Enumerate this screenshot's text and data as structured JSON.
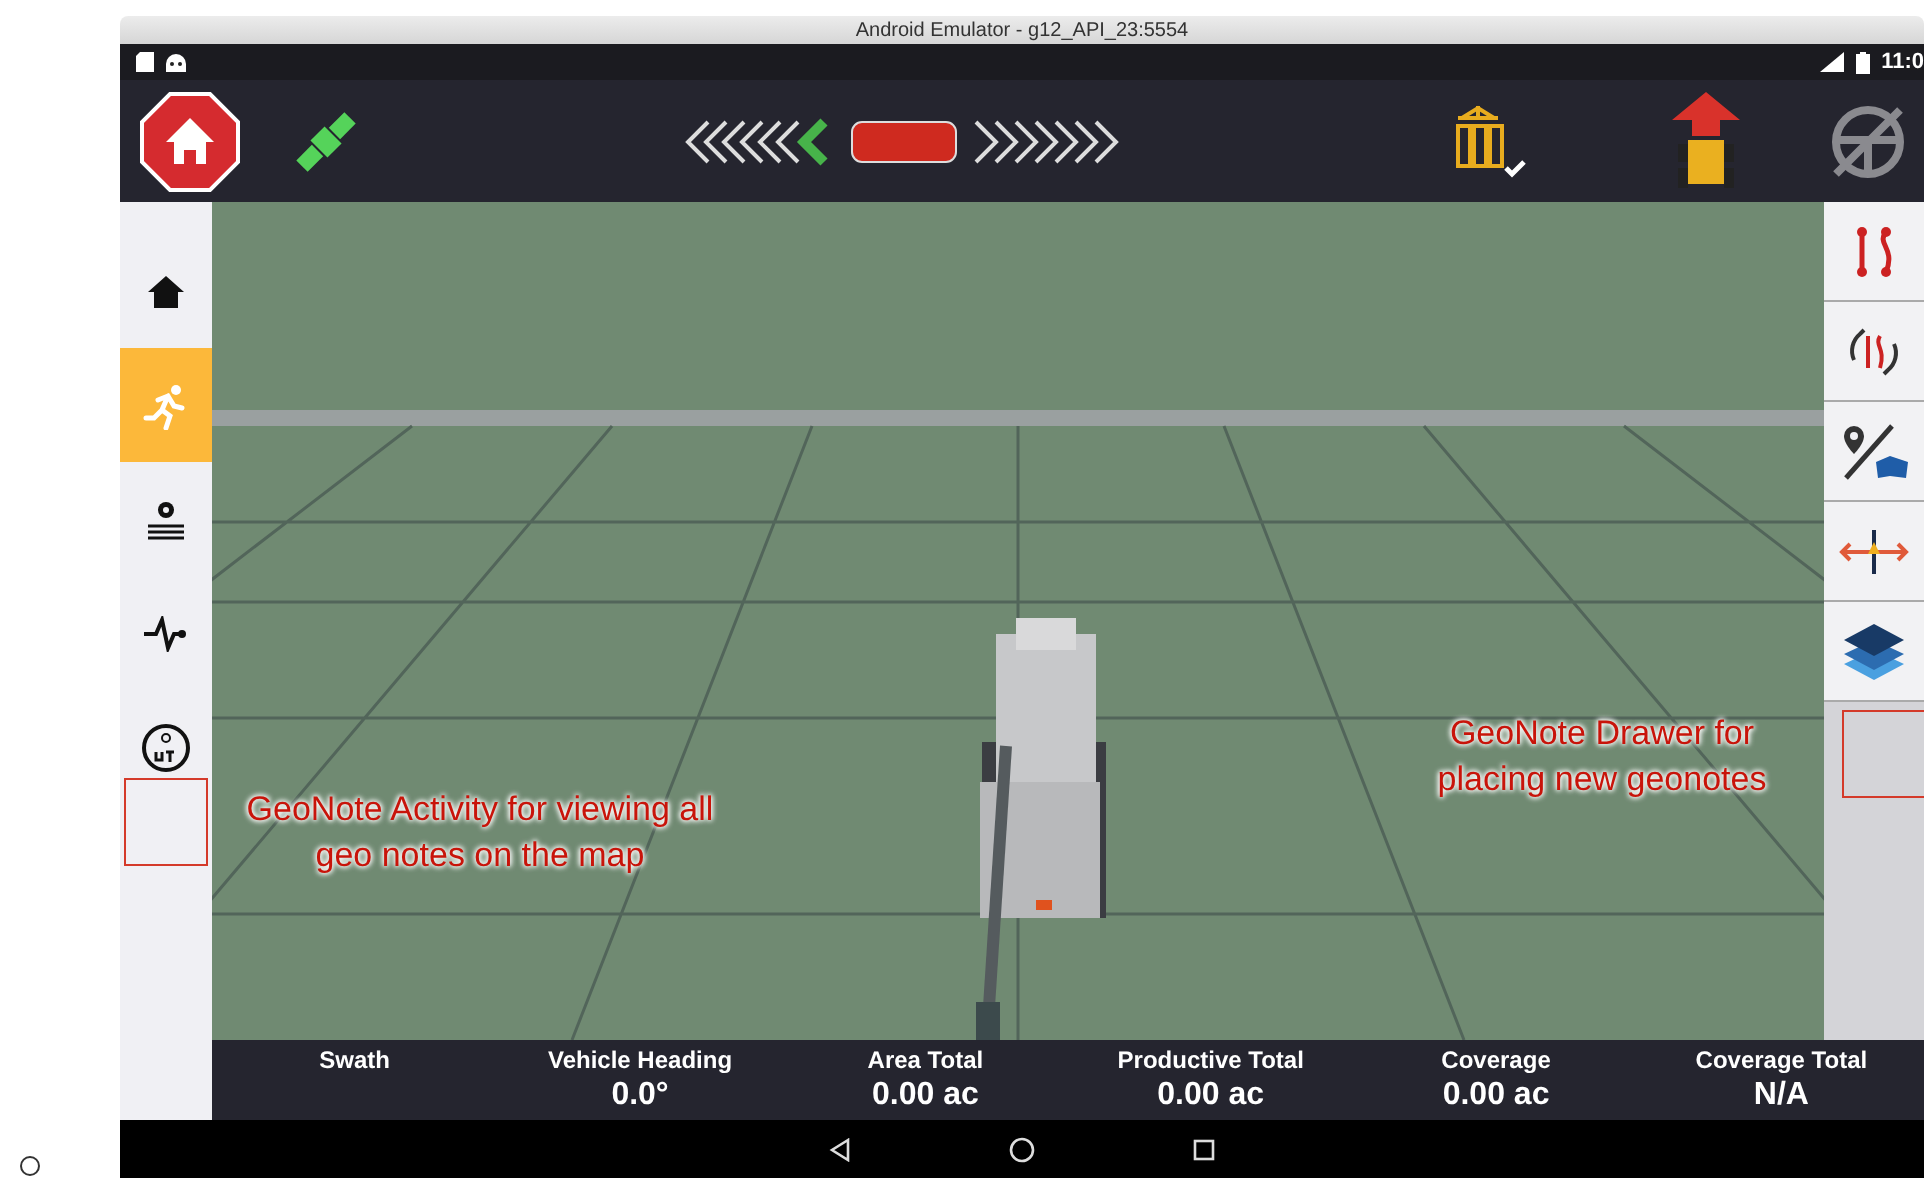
{
  "window": {
    "title": "Android Emulator - g12_API_23:5554"
  },
  "status_bar": {
    "time": "11:0"
  },
  "sidebar": {
    "items": [
      {
        "kind": "home",
        "selected": false
      },
      {
        "kind": "runner",
        "selected": true
      },
      {
        "kind": "field",
        "selected": false
      },
      {
        "kind": "pulse",
        "selected": false
      },
      {
        "kind": "ut",
        "selected": false
      }
    ]
  },
  "tools": {
    "items": [
      {
        "kind": "path"
      },
      {
        "kind": "cycle"
      },
      {
        "kind": "pin"
      },
      {
        "kind": "shift"
      },
      {
        "kind": "layers"
      }
    ]
  },
  "annotations": {
    "left_note": "GeoNote Activity for viewing all geo notes on the map",
    "right_note": "GeoNote Drawer for placing new geonotes"
  },
  "stats": [
    {
      "label": "Swath"
    },
    {
      "label": "Vehicle Heading",
      "value": "0.0°"
    },
    {
      "label": "Area Total",
      "value": "0.00 ac"
    },
    {
      "label": "Productive Total",
      "value": "0.00 ac"
    },
    {
      "label": "Coverage",
      "value": "0.00 ac"
    },
    {
      "label": "Coverage Total",
      "value": "N/A"
    }
  ]
}
